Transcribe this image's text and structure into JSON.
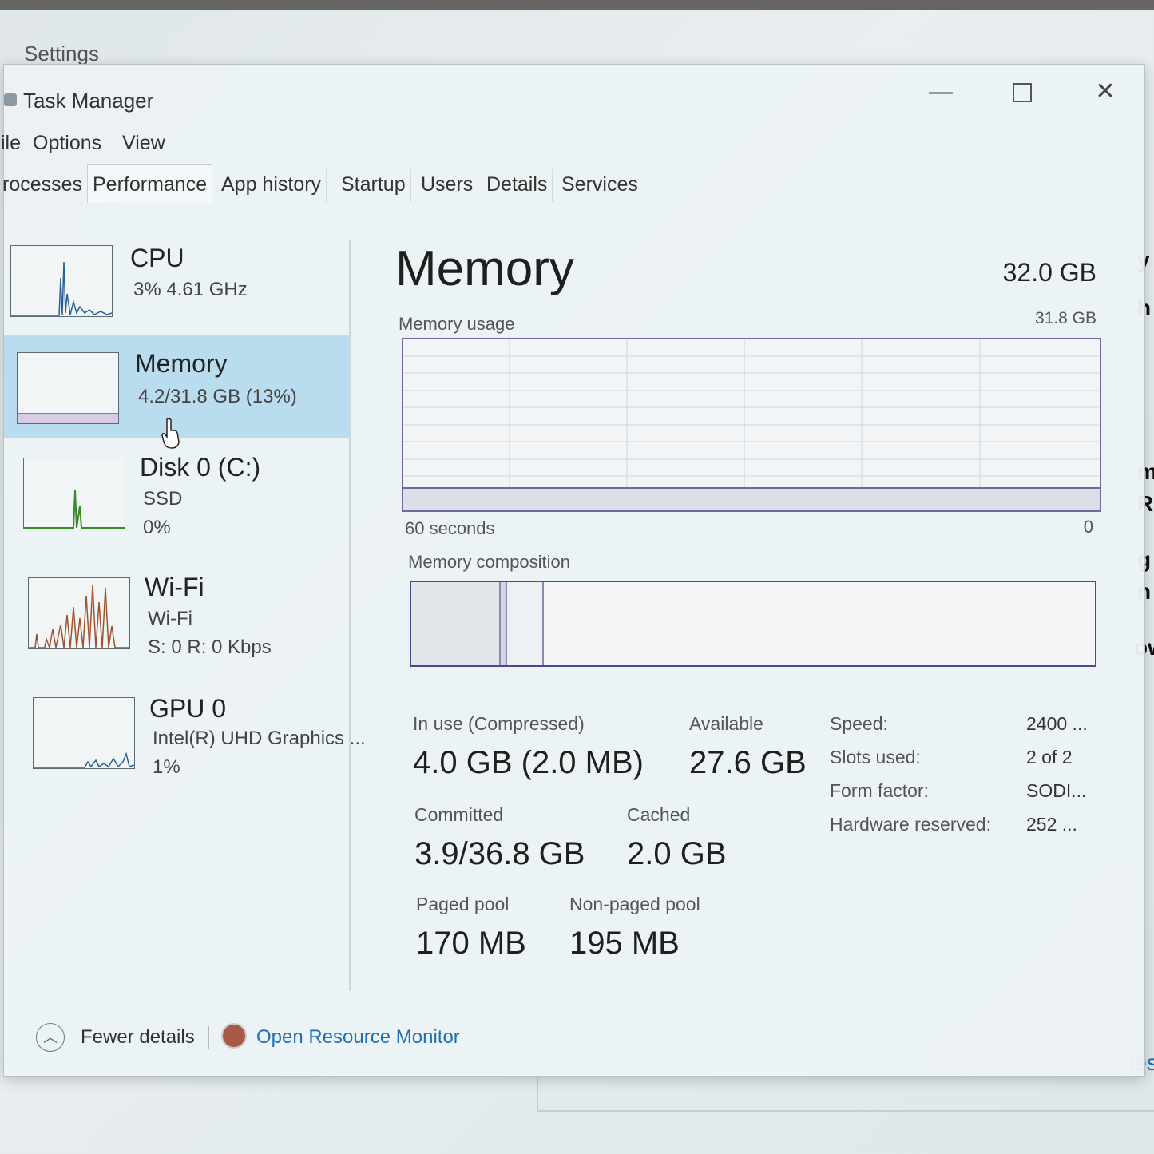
{
  "background": {
    "title": "Settings",
    "right_edge_fragments": [
      "y",
      "h",
      "m",
      "R",
      "g",
      "n",
      "ow",
      "ies"
    ]
  },
  "window": {
    "title": "Task Manager",
    "controls": {
      "minimize": "—",
      "maximize": "",
      "close": "✕"
    }
  },
  "menu": [
    "ile",
    "Options",
    "View"
  ],
  "tabs": [
    "rocesses",
    "Performance",
    "App history",
    "Startup",
    "Users",
    "Details",
    "Services"
  ],
  "active_tab": "Performance",
  "sidebar": [
    {
      "name": "CPU",
      "line1": "3%  4.61 GHz",
      "line2": "",
      "color": "#2a5f95"
    },
    {
      "name": "Memory",
      "line1": "4.2/31.8 GB (13%)",
      "line2": "",
      "color": "#7a3ea8",
      "selected": true
    },
    {
      "name": "Disk 0 (C:)",
      "line1": "SSD",
      "line2": "0%",
      "color": "#3a8a2a"
    },
    {
      "name": "Wi-Fi",
      "line1": "Wi-Fi",
      "line2": "S: 0  R: 0 Kbps",
      "color": "#a0522d"
    },
    {
      "name": "GPU 0",
      "line1": "Intel(R) UHD Graphics ...",
      "line2": "1%",
      "color": "#2a5f95"
    }
  ],
  "main": {
    "title": "Memory",
    "total": "32.0 GB",
    "usage_label": "Memory usage",
    "usage_max": "31.8 GB",
    "axis_left": "60 seconds",
    "axis_right": "0",
    "composition_label": "Memory composition",
    "stats": {
      "in_use_label": "In use (Compressed)",
      "in_use_value": "4.0 GB (2.0 MB)",
      "available_label": "Available",
      "available_value": "27.6 GB",
      "committed_label": "Committed",
      "committed_value": "3.9/36.8 GB",
      "cached_label": "Cached",
      "cached_value": "2.0 GB",
      "paged_label": "Paged pool",
      "paged_value": "170 MB",
      "nonpaged_label": "Non-paged pool",
      "nonpaged_value": "195 MB"
    },
    "details": [
      {
        "key": "Speed:",
        "value": "2400 ..."
      },
      {
        "key": "Slots used:",
        "value": "2 of 2"
      },
      {
        "key": "Form factor:",
        "value": "SODI..."
      },
      {
        "key": "Hardware reserved:",
        "value": "252 ..."
      }
    ]
  },
  "footer": {
    "fewer_details": "Fewer details",
    "open_resource_monitor": "Open Resource Monitor"
  }
}
